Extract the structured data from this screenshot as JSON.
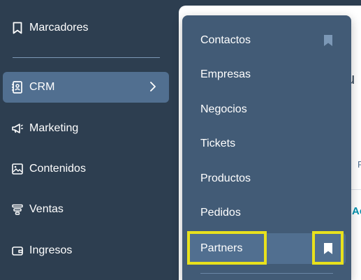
{
  "sidebar": {
    "items": [
      {
        "label": "Marcadores",
        "icon": "bookmark-icon"
      },
      {
        "label": "CRM",
        "icon": "contacts-book-icon",
        "active": true,
        "chevron": "chevron-right-icon"
      },
      {
        "label": "Marketing",
        "icon": "megaphone-icon"
      },
      {
        "label": "Contenidos",
        "icon": "image-content-icon"
      },
      {
        "label": "Ventas",
        "icon": "sales-funnel-icon"
      },
      {
        "label": "Ingresos",
        "icon": "wallet-icon"
      }
    ]
  },
  "crm_menu": {
    "items": [
      {
        "label": "Contactos",
        "bookmarked": true
      },
      {
        "label": "Empresas"
      },
      {
        "label": "Negocios"
      },
      {
        "label": "Tickets"
      },
      {
        "label": "Productos"
      },
      {
        "label": "Pedidos"
      },
      {
        "label": "Partners",
        "highlighted": true,
        "bookmarked": true
      }
    ]
  },
  "background_fragments": {
    "heading_fragment": "u",
    "text_fragment": "F",
    "link_fragment": "Ac"
  },
  "colors": {
    "sidebar_bg": "#2d3e50",
    "active_item_bg": "#516f90",
    "dropdown_bg": "#425b76",
    "highlight_outline": "#e8e11d",
    "bookmark_icon": "#7c98b6",
    "link_accent": "#0091ae"
  }
}
